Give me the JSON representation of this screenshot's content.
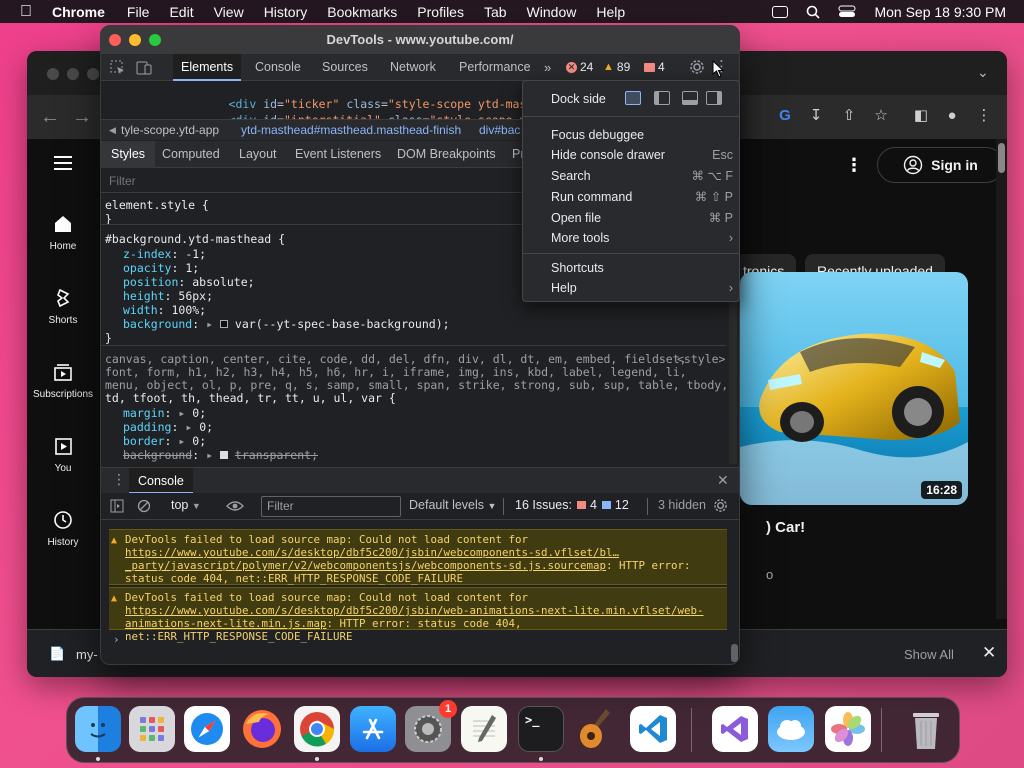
{
  "menubar": {
    "app_name": "Chrome",
    "items": [
      "File",
      "Edit",
      "View",
      "History",
      "Bookmarks",
      "Profiles",
      "Tab",
      "Window",
      "Help"
    ],
    "clock": "Mon Sep 18  9:30 PM"
  },
  "browser": {
    "sidebar": [
      {
        "label": "Home",
        "icon": "home-icon"
      },
      {
        "label": "Shorts",
        "icon": "shorts-icon"
      },
      {
        "label": "Subscriptions",
        "icon": "subscriptions-icon"
      },
      {
        "label": "You",
        "icon": "you-icon"
      },
      {
        "label": "History",
        "icon": "history-icon"
      }
    ],
    "signin_label": "Sign in",
    "chips": [
      "tronics",
      "Recently uploaded"
    ],
    "video": {
      "duration": "16:28",
      "title_fragment": ") Car!",
      "subtitle_fragment": "o"
    },
    "download_bar": {
      "file_fragment": "my-",
      "show_all": "Show All"
    }
  },
  "devtools": {
    "window_title": "DevTools - www.youtube.com/",
    "tabs": [
      "Elements",
      "Console",
      "Sources",
      "Network",
      "Performance"
    ],
    "active_tab": "Elements",
    "counts": {
      "errors": "24",
      "warnings": "89",
      "issues": "4"
    },
    "dom_lines": [
      {
        "tag": "div",
        "id": "ticker",
        "class": "style-scope ytd-masthead"
      },
      {
        "tag": "div",
        "id": "interstitial",
        "class": "style-scope ytd-masth"
      }
    ],
    "breadcrumbs": [
      "tyle-scope.ytd-app",
      "ytd-masthead#masthead.masthead-finish",
      "div#bac"
    ],
    "style_tabs": [
      "Styles",
      "Computed",
      "Layout",
      "Event Listeners",
      "DOM Breakpoints",
      "Pr"
    ],
    "filter_placeholder": "Filter",
    "element_style": "element.style {",
    "rule_selector": "#background.ytd-masthead {",
    "rule_props": [
      {
        "name": "z-index",
        "value": "-1;"
      },
      {
        "name": "opacity",
        "value": "1;"
      },
      {
        "name": "position",
        "value": "absolute;"
      },
      {
        "name": "height",
        "value": "56px;"
      },
      {
        "name": "width",
        "value": "100%;"
      },
      {
        "name": "background",
        "value": "var(--yt-spec-base-background);"
      }
    ],
    "ua_selector_lines": [
      "canvas, caption, center, cite, code, dd, del, dfn, div, dl, dt, em, embed, fieldset,",
      "font, form, h1, h2, h3, h4, h5, h6, hr, i, iframe, img, ins, kbd, label, legend, li,",
      "menu, object, ol, p, pre, q, s, samp, small, span, strike, strong, sub, sup, table, tbody,",
      "td, tfoot, th, thead, tr, tt, u, ul, var {"
    ],
    "ua_source": "<style>",
    "ua_props": [
      {
        "name": "margin",
        "value": "0;"
      },
      {
        "name": "padding",
        "value": "0;"
      },
      {
        "name": "border",
        "value": "0;"
      },
      {
        "name": "background",
        "value": "transparent;"
      }
    ],
    "console": {
      "tab_label": "Console",
      "context": "top",
      "filter_placeholder": "Filter",
      "levels": "Default levels",
      "issues_label": "16 Issues:",
      "issues_red": "4",
      "issues_blue": "12",
      "hidden": "3 hidden",
      "messages": [
        {
          "prefix": "DevTools failed to load source map: Could not load content for ",
          "link": "https://www.youtube.com/s/desktop/dbf5c200/jsbin/webcomponents-sd.vflset/bl…_party/javascript/polymer/v2/webcomponentsjs/webcomponents-sd.js.sourcemap",
          "suffix": ": HTTP error: status code 404, net::ERR_HTTP_RESPONSE_CODE_FAILURE"
        },
        {
          "prefix": "DevTools failed to load source map: Could not load content for ",
          "link": "https://www.youtube.com/s/desktop/dbf5c200/jsbin/web-animations-next-lite.min.vflset/web-animations-next-lite.min.js.map",
          "suffix": ": HTTP error: status code 404, net::ERR_HTTP_RESPONSE_CODE_FAILURE"
        }
      ]
    }
  },
  "menu": {
    "dock_side_label": "Dock side",
    "items": [
      {
        "label": "Focus debuggee",
        "shortcut": ""
      },
      {
        "label": "Hide console drawer",
        "shortcut": "Esc"
      },
      {
        "label": "Search",
        "shortcut": "⌘ ⌥ F"
      },
      {
        "label": "Run command",
        "shortcut": "⌘ ⇧ P"
      },
      {
        "label": "Open file",
        "shortcut": "⌘ P"
      },
      {
        "label": "More tools",
        "shortcut": "›"
      }
    ],
    "items2": [
      {
        "label": "Shortcuts",
        "shortcut": ""
      },
      {
        "label": "Help",
        "shortcut": "›"
      }
    ]
  },
  "dock": {
    "apps": [
      "Finder",
      "Launchpad",
      "Safari",
      "Firefox",
      "Chrome",
      "App Store",
      "System Settings",
      "TextEdit",
      "Terminal",
      "GarageBand",
      "VS Code",
      "Visual Studio",
      "Weather",
      "Photos",
      "Trash"
    ],
    "settings_badge": "1"
  }
}
